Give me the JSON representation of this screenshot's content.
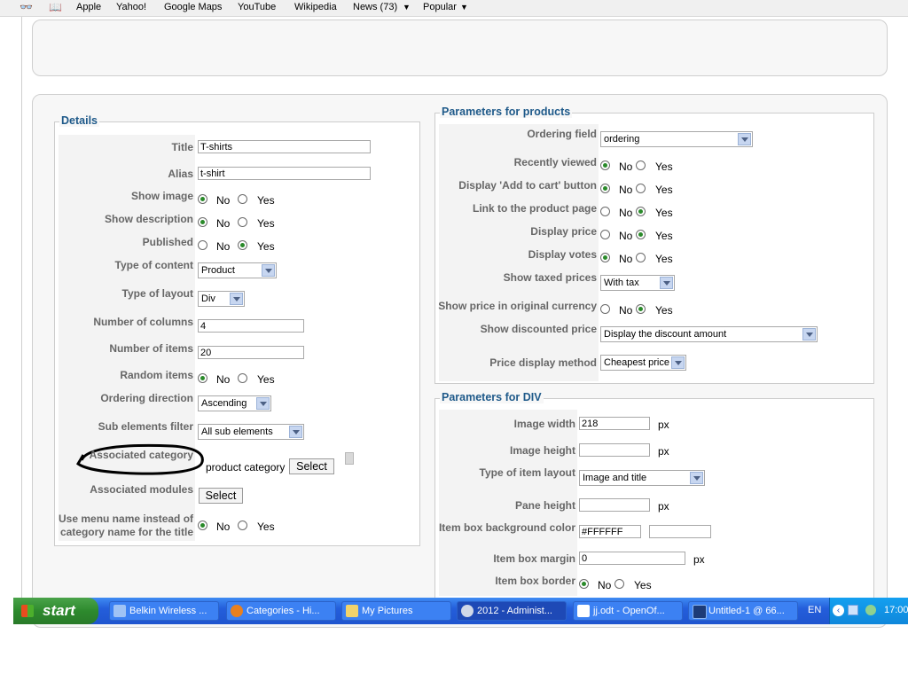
{
  "bookmarks_bar": {
    "items": [
      "Apple",
      "Yahoo!",
      "Google Maps",
      "YouTube",
      "Wikipedia",
      "News (73)",
      "Popular"
    ],
    "icons": [
      "reading-glasses-icon",
      "open-book-icon"
    ]
  },
  "details": {
    "legend": "Details",
    "title_label": "Title",
    "title_value": "T-shirts",
    "alias_label": "Alias",
    "alias_value": "t-shirt",
    "show_image_label": "Show image",
    "show_description_label": "Show description",
    "published_label": "Published",
    "type_of_content_label": "Type of content",
    "type_of_content_value": "Product",
    "type_of_layout_label": "Type of layout",
    "type_of_layout_value": "Div",
    "number_of_columns_label": "Number of columns",
    "number_of_columns_value": "4",
    "number_of_items_label": "Number of items",
    "number_of_items_value": "20",
    "random_items_label": "Random items",
    "ordering_direction_label": "Ordering direction",
    "ordering_direction_value": "Ascending",
    "sub_elements_filter_label": "Sub elements filter",
    "sub_elements_filter_value": "All sub elements",
    "associated_category_label": "Associated category",
    "associated_category_value": "product category",
    "associated_modules_label": "Associated modules",
    "use_menu_name_label_1": "Use menu name instead of",
    "use_menu_name_label_2": "category name for the title",
    "select_label": "Select"
  },
  "radio": {
    "no": "No",
    "yes": "Yes"
  },
  "params_products": {
    "legend": "Parameters for products",
    "ordering_field_label": "Ordering field",
    "ordering_field_value": "ordering",
    "recently_viewed_label": "Recently viewed",
    "display_add_to_cart_label": "Display 'Add to cart' button",
    "link_to_product_page_label": "Link to the product page",
    "display_price_label": "Display price",
    "display_votes_label": "Display votes",
    "show_taxed_prices_label": "Show taxed prices",
    "show_taxed_prices_value": "With tax",
    "show_price_original_currency_label": "Show price in original currency",
    "show_discounted_price_label": "Show discounted price",
    "show_discounted_price_value": "Display the discount amount",
    "price_display_method_label": "Price display method",
    "price_display_method_value": "Cheapest price"
  },
  "params_div": {
    "legend": "Parameters for DIV",
    "image_width_label": "Image width",
    "image_width_value": "218",
    "image_height_label": "Image height",
    "image_height_value": "",
    "type_of_item_layout_label": "Type of item layout",
    "type_of_item_layout_value": "Image and title",
    "pane_height_label": "Pane height",
    "pane_height_value": "",
    "item_box_bg_color_label": "Item box background color",
    "item_box_bg_color_value": "#FFFFFF",
    "item_box_margin_label": "Item box margin",
    "item_box_margin_value": "0",
    "item_box_border_label": "Item box border",
    "unit_px": "px"
  },
  "taskbar": {
    "start_label": "start",
    "tasks": [
      "Belkin Wireless ...",
      "Categories - Hi...",
      "My Pictures",
      "2012 - Administ...",
      "jj.odt - OpenOf...",
      "Untitled-1 @ 66..."
    ],
    "language": "EN",
    "clock": "17:00"
  },
  "colors": {
    "legend_text": "#1f5a8a",
    "label_text": "#666666",
    "taskbar_blue": "#245edb",
    "start_green": "#2d8a2d",
    "radio_checked": "#2a8a2a"
  }
}
